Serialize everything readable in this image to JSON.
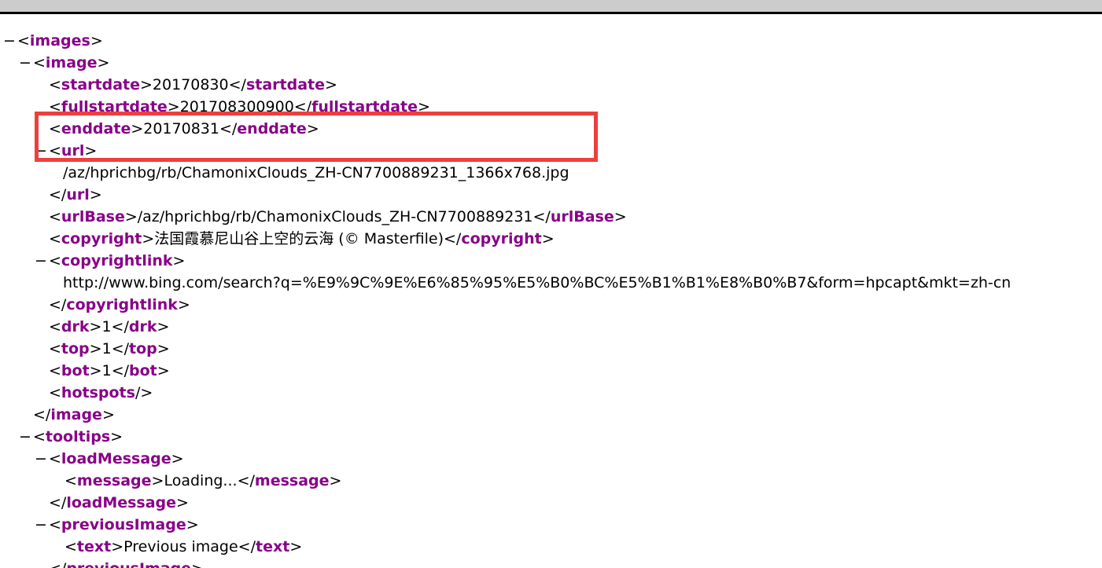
{
  "window": {
    "topbar_color": "#cccccc"
  },
  "colors": {
    "tag": "#880088",
    "highlight": "#ef3e3e"
  },
  "xml": {
    "toggle_symbol": "−",
    "highlight_note": "red box around <url> element",
    "lines": [
      {
        "indent": 0,
        "toggle": true,
        "parts": [
          [
            "p",
            "<"
          ],
          [
            "t",
            "images"
          ],
          [
            "p",
            ">"
          ]
        ]
      },
      {
        "indent": 1,
        "toggle": true,
        "parts": [
          [
            "p",
            "<"
          ],
          [
            "t",
            "image"
          ],
          [
            "p",
            ">"
          ]
        ]
      },
      {
        "indent": 2,
        "toggle": false,
        "parts": [
          [
            "p",
            "<"
          ],
          [
            "t",
            "startdate"
          ],
          [
            "p",
            ">"
          ],
          [
            "x",
            "20170830"
          ],
          [
            "p",
            "</"
          ],
          [
            "t",
            "startdate"
          ],
          [
            "p",
            ">"
          ]
        ]
      },
      {
        "indent": 2,
        "toggle": false,
        "parts": [
          [
            "p",
            "<"
          ],
          [
            "t",
            "fullstartdate"
          ],
          [
            "p",
            ">"
          ],
          [
            "x",
            "201708300900"
          ],
          [
            "p",
            "</"
          ],
          [
            "t",
            "fullstartdate"
          ],
          [
            "p",
            ">"
          ]
        ]
      },
      {
        "indent": 2,
        "toggle": false,
        "parts": [
          [
            "p",
            "<"
          ],
          [
            "t",
            "enddate"
          ],
          [
            "p",
            ">"
          ],
          [
            "x",
            "20170831"
          ],
          [
            "p",
            "</"
          ],
          [
            "t",
            "enddate"
          ],
          [
            "p",
            ">"
          ]
        ]
      },
      {
        "indent": 2,
        "toggle": true,
        "parts": [
          [
            "p",
            "<"
          ],
          [
            "t",
            "url"
          ],
          [
            "p",
            ">"
          ]
        ]
      },
      {
        "indent": 3,
        "toggle": false,
        "parts": [
          [
            "x",
            "/az/hprichbg/rb/ChamonixClouds_ZH-CN7700889231_1366x768.jpg"
          ]
        ]
      },
      {
        "indent": 2,
        "toggle": false,
        "parts": [
          [
            "p",
            "</"
          ],
          [
            "t",
            "url"
          ],
          [
            "p",
            ">"
          ]
        ]
      },
      {
        "indent": 2,
        "toggle": false,
        "parts": [
          [
            "p",
            "<"
          ],
          [
            "t",
            "urlBase"
          ],
          [
            "p",
            ">"
          ],
          [
            "x",
            "/az/hprichbg/rb/ChamonixClouds_ZH-CN7700889231"
          ],
          [
            "p",
            "</"
          ],
          [
            "t",
            "urlBase"
          ],
          [
            "p",
            ">"
          ]
        ]
      },
      {
        "indent": 2,
        "toggle": false,
        "parts": [
          [
            "p",
            "<"
          ],
          [
            "t",
            "copyright"
          ],
          [
            "p",
            ">"
          ],
          [
            "x",
            "法国霞慕尼山谷上空的云海 (© Masterfile)"
          ],
          [
            "p",
            "</"
          ],
          [
            "t",
            "copyright"
          ],
          [
            "p",
            ">"
          ]
        ]
      },
      {
        "indent": 2,
        "toggle": true,
        "parts": [
          [
            "p",
            "<"
          ],
          [
            "t",
            "copyrightlink"
          ],
          [
            "p",
            ">"
          ]
        ]
      },
      {
        "indent": 3,
        "toggle": false,
        "parts": [
          [
            "x",
            "http://www.bing.com/search?q=%E9%9C%9E%E6%85%95%E5%B0%BC%E5%B1%B1%E8%B0%B7&form=hpcapt&mkt=zh-cn"
          ]
        ]
      },
      {
        "indent": 2,
        "toggle": false,
        "parts": [
          [
            "p",
            "</"
          ],
          [
            "t",
            "copyrightlink"
          ],
          [
            "p",
            ">"
          ]
        ]
      },
      {
        "indent": 2,
        "toggle": false,
        "parts": [
          [
            "p",
            "<"
          ],
          [
            "t",
            "drk"
          ],
          [
            "p",
            ">"
          ],
          [
            "x",
            "1"
          ],
          [
            "p",
            "</"
          ],
          [
            "t",
            "drk"
          ],
          [
            "p",
            ">"
          ]
        ]
      },
      {
        "indent": 2,
        "toggle": false,
        "parts": [
          [
            "p",
            "<"
          ],
          [
            "t",
            "top"
          ],
          [
            "p",
            ">"
          ],
          [
            "x",
            "1"
          ],
          [
            "p",
            "</"
          ],
          [
            "t",
            "top"
          ],
          [
            "p",
            ">"
          ]
        ]
      },
      {
        "indent": 2,
        "toggle": false,
        "parts": [
          [
            "p",
            "<"
          ],
          [
            "t",
            "bot"
          ],
          [
            "p",
            ">"
          ],
          [
            "x",
            "1"
          ],
          [
            "p",
            "</"
          ],
          [
            "t",
            "bot"
          ],
          [
            "p",
            ">"
          ]
        ]
      },
      {
        "indent": 2,
        "toggle": false,
        "parts": [
          [
            "p",
            "<"
          ],
          [
            "t",
            "hotspots"
          ],
          [
            "p",
            "/>"
          ]
        ]
      },
      {
        "indent": 1,
        "toggle": false,
        "parts": [
          [
            "p",
            "</"
          ],
          [
            "t",
            "image"
          ],
          [
            "p",
            ">"
          ]
        ]
      },
      {
        "indent": 1,
        "toggle": true,
        "parts": [
          [
            "p",
            "<"
          ],
          [
            "t",
            "tooltips"
          ],
          [
            "p",
            ">"
          ]
        ]
      },
      {
        "indent": 2,
        "toggle": true,
        "parts": [
          [
            "p",
            "<"
          ],
          [
            "t",
            "loadMessage"
          ],
          [
            "p",
            ">"
          ]
        ]
      },
      {
        "indent": 3,
        "toggle": false,
        "parts": [
          [
            "p",
            "<"
          ],
          [
            "t",
            "message"
          ],
          [
            "p",
            ">"
          ],
          [
            "x",
            "Loading..."
          ],
          [
            "p",
            "</"
          ],
          [
            "t",
            "message"
          ],
          [
            "p",
            ">"
          ]
        ]
      },
      {
        "indent": 2,
        "toggle": false,
        "parts": [
          [
            "p",
            "</"
          ],
          [
            "t",
            "loadMessage"
          ],
          [
            "p",
            ">"
          ]
        ]
      },
      {
        "indent": 2,
        "toggle": true,
        "parts": [
          [
            "p",
            "<"
          ],
          [
            "t",
            "previousImage"
          ],
          [
            "p",
            ">"
          ]
        ]
      },
      {
        "indent": 3,
        "toggle": false,
        "parts": [
          [
            "p",
            "<"
          ],
          [
            "t",
            "text"
          ],
          [
            "p",
            ">"
          ],
          [
            "x",
            "Previous image"
          ],
          [
            "p",
            "</"
          ],
          [
            "t",
            "text"
          ],
          [
            "p",
            ">"
          ]
        ]
      },
      {
        "indent": 2,
        "toggle": false,
        "parts": [
          [
            "p",
            "</"
          ],
          [
            "t",
            "previousImage"
          ],
          [
            "p",
            ">"
          ]
        ]
      }
    ]
  }
}
